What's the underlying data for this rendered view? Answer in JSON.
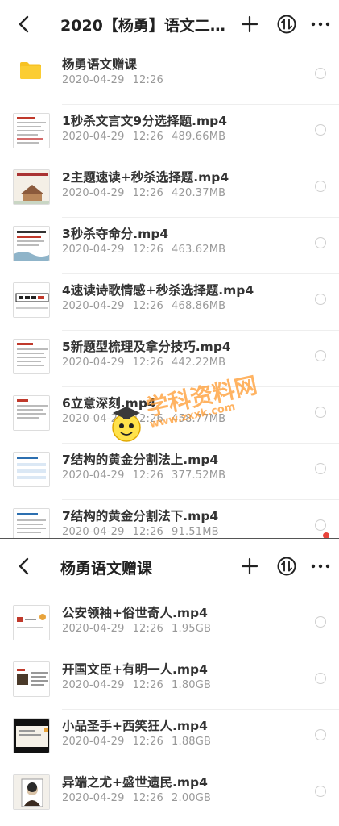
{
  "top_panel": {
    "title": "2020【杨勇】语文二轮...",
    "items": [
      {
        "name": "杨勇语文赠课",
        "date": "2020-04-29",
        "time": "12:26",
        "size": "",
        "type": "folder"
      },
      {
        "name": "1秒杀文言文9分选择题.mp4",
        "date": "2020-04-29",
        "time": "12:26",
        "size": "489.66MB",
        "type": "video"
      },
      {
        "name": "2主题速读+秒杀选择题.mp4",
        "date": "2020-04-29",
        "time": "12:26",
        "size": "420.37MB",
        "type": "video"
      },
      {
        "name": "3秒杀夺命分.mp4",
        "date": "2020-04-29",
        "time": "12:26",
        "size": "463.62MB",
        "type": "video"
      },
      {
        "name": "4速读诗歌情感+秒杀选择题.mp4",
        "date": "2020-04-29",
        "time": "12:26",
        "size": "468.86MB",
        "type": "video"
      },
      {
        "name": "5新题型梳理及拿分技巧.mp4",
        "date": "2020-04-29",
        "time": "12:26",
        "size": "442.22MB",
        "type": "video"
      },
      {
        "name": "6立意深刻.mp4",
        "date": "2020-04-29",
        "time": "12:26",
        "size": "458.77MB",
        "type": "video"
      },
      {
        "name": "7结构的黄金分割法上.mp4",
        "date": "2020-04-29",
        "time": "12:26",
        "size": "377.52MB",
        "type": "video"
      },
      {
        "name": "7结构的黄金分割法下.mp4",
        "date": "2020-04-29",
        "time": "12:26",
        "size": "91.51MB",
        "type": "video"
      }
    ]
  },
  "bottom_panel": {
    "title": "杨勇语文赠课",
    "items": [
      {
        "name": "公安领袖+俗世奇人.mp4",
        "date": "2020-04-29",
        "time": "12:26",
        "size": "1.95GB"
      },
      {
        "name": "开国文臣+有明一人.mp4",
        "date": "2020-04-29",
        "time": "12:26",
        "size": "1.80GB"
      },
      {
        "name": "小品圣手+西笑狂人.mp4",
        "date": "2020-04-29",
        "time": "12:26",
        "size": "1.88GB"
      },
      {
        "name": "异端之尤+盛世遗民.mp4",
        "date": "2020-04-29",
        "time": "12:26",
        "size": "2.00GB"
      }
    ]
  },
  "watermark": {
    "text": "学科资料网",
    "url": "www.zxxk.com"
  },
  "icons": {
    "back": "chevron-left-icon",
    "add": "plus-icon",
    "sort": "sort-arrows-icon",
    "more": "more-dots-icon",
    "folder": "folder-icon",
    "select": "radio-circle-icon"
  },
  "colors": {
    "folder": "#f7c224",
    "accent": "#e8433a",
    "meta": "#999999",
    "watermark": "#ff9a2e"
  }
}
